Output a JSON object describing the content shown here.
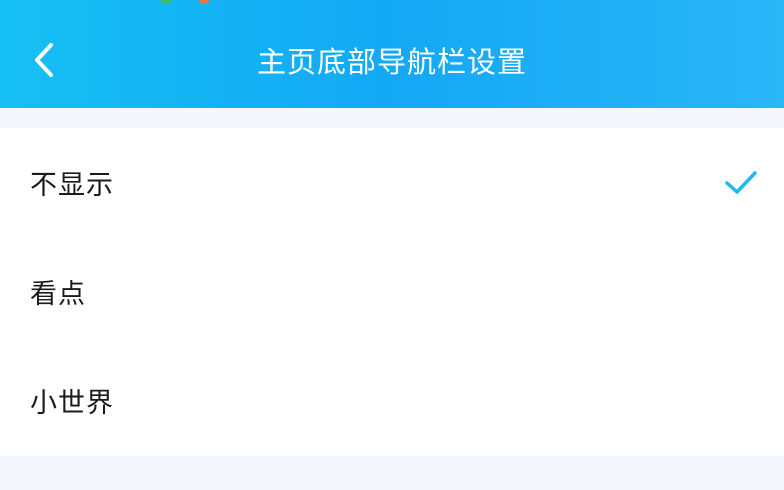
{
  "header": {
    "title": "主页底部导航栏设置",
    "back_icon": "chevron-left-icon",
    "gradient_start": "#16c0f4",
    "gradient_end": "#2ab6f7"
  },
  "options": [
    {
      "label": "不显示",
      "selected": true
    },
    {
      "label": "看点",
      "selected": false
    },
    {
      "label": "小世界",
      "selected": false
    }
  ],
  "colors": {
    "accent": "#1fb8ef",
    "background": "#f4f7fb",
    "text": "#1b1b1b"
  }
}
